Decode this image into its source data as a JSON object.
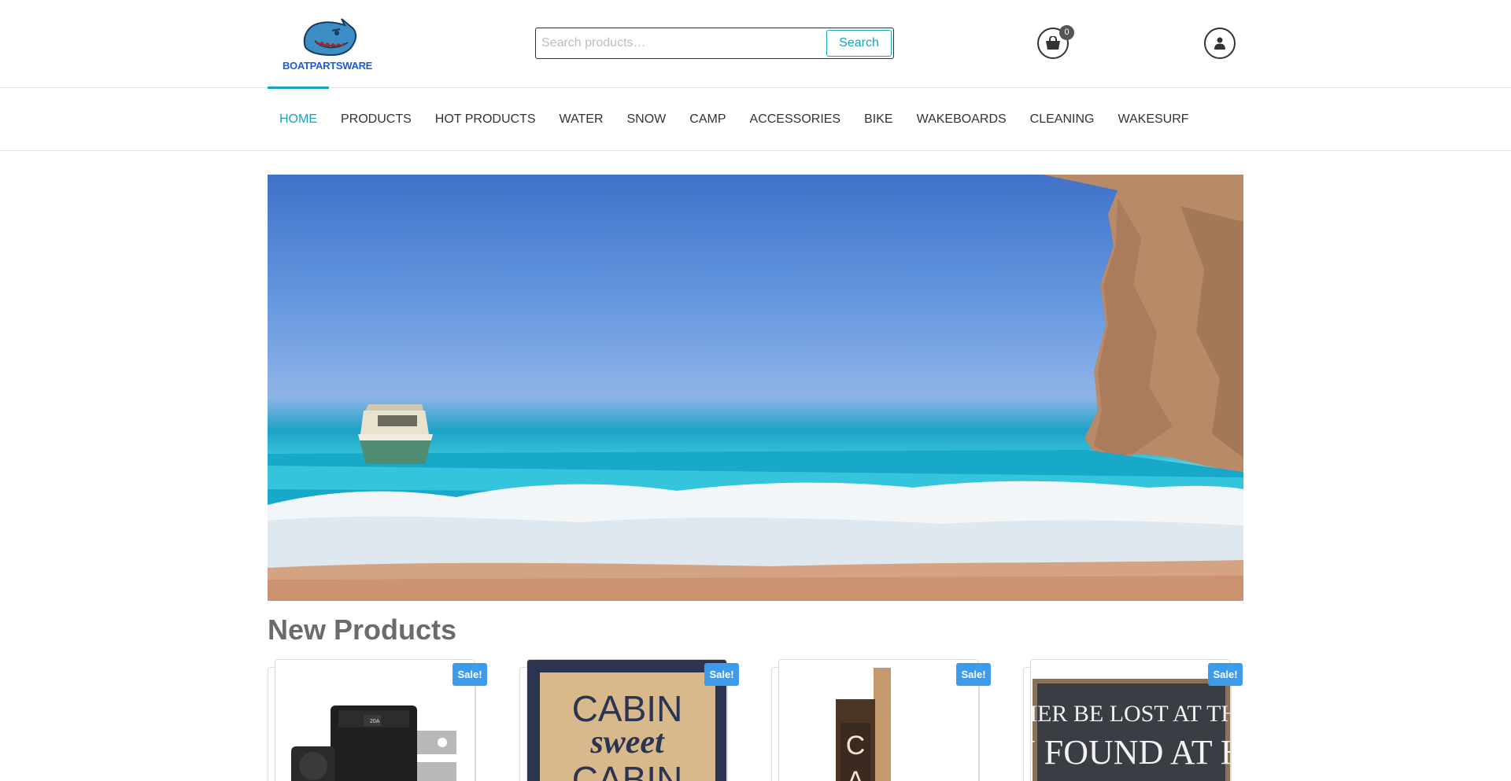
{
  "header": {
    "logo_text": "BOATPARTSWARE",
    "search": {
      "placeholder": "Search products…",
      "value": "",
      "button_label": "Search"
    },
    "cart": {
      "count": "0"
    }
  },
  "nav": {
    "items": [
      {
        "label": "HOME",
        "active": true
      },
      {
        "label": "PRODUCTS"
      },
      {
        "label": "HOT PRODUCTS"
      },
      {
        "label": "WATER"
      },
      {
        "label": "SNOW"
      },
      {
        "label": "CAMP"
      },
      {
        "label": "ACCESSORIES"
      },
      {
        "label": "BIKE"
      },
      {
        "label": "WAKEBOARDS"
      },
      {
        "label": "CLEANING"
      },
      {
        "label": "WAKESURF"
      }
    ]
  },
  "section": {
    "title": "New Products"
  },
  "products": [
    {
      "badge": "Sale!",
      "image_text": ""
    },
    {
      "badge": "Sale!",
      "image_text": "CABIN sweet CABIN"
    },
    {
      "badge": "Sale!",
      "image_text": "CA"
    },
    {
      "badge": "Sale!",
      "image_text": "I'D RATHER BE LOST AT THE LAKE THAN FOUND AT HOME"
    }
  ],
  "colors": {
    "accent": "#17a2c2",
    "sale_badge": "#3d9be9",
    "logo_blue": "#1e5bd6"
  }
}
